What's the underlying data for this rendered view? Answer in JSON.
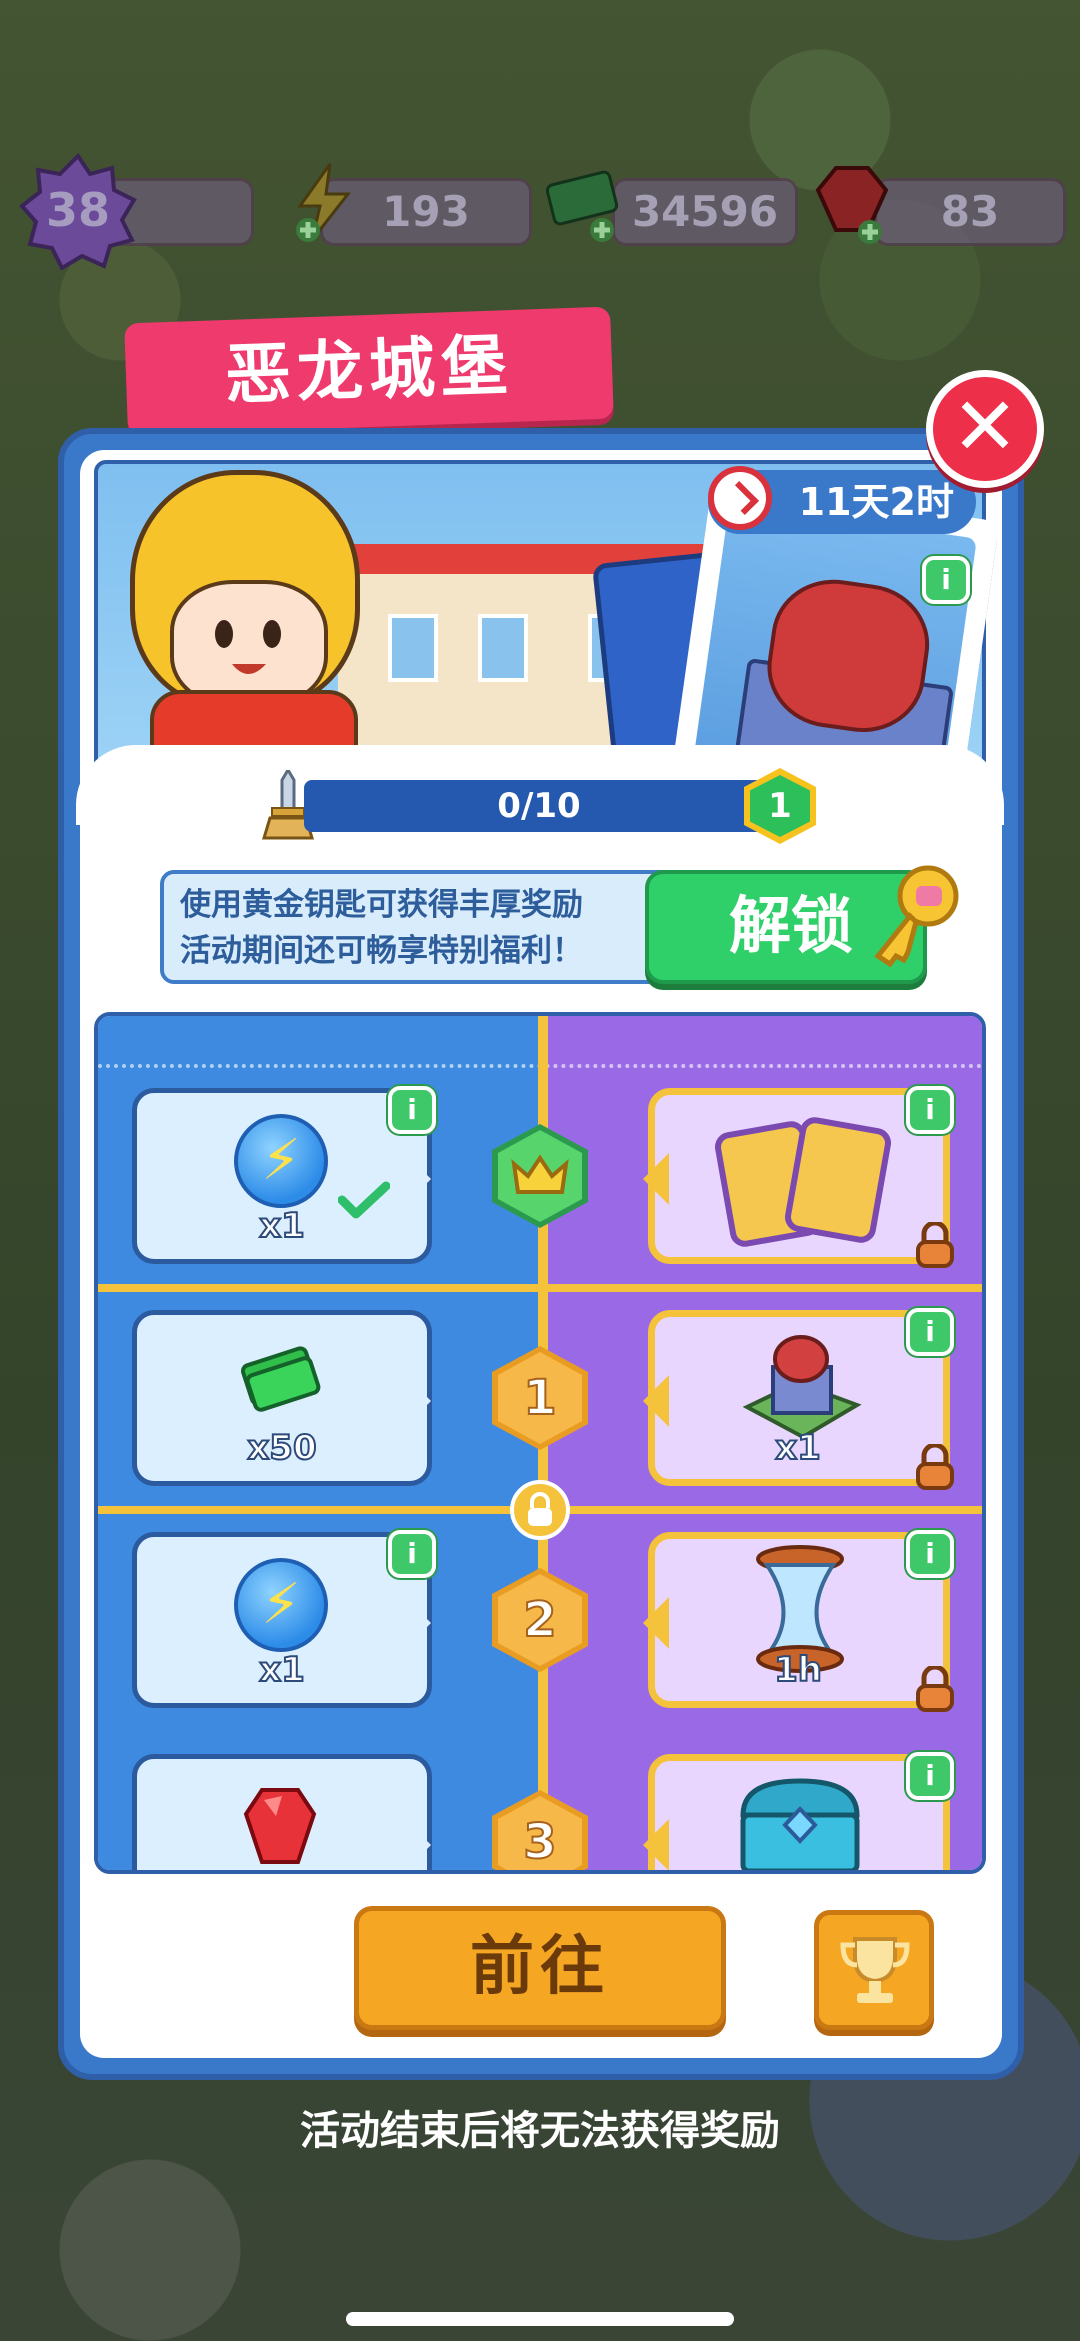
{
  "resources": [
    {
      "name": "level",
      "value": "38"
    },
    {
      "name": "energy",
      "value": "193"
    },
    {
      "name": "cash",
      "value": "34596"
    },
    {
      "name": "gems",
      "value": "83"
    }
  ],
  "window": {
    "title": "恶龙城堡",
    "close_label": "✕",
    "timer": "11天2时"
  },
  "progress": {
    "text": "0/10",
    "level": "1"
  },
  "unlock": {
    "line1": "使用黄金钥匙可获得丰厚奖励",
    "line2": "活动期间还可畅享特别福利！",
    "button": "解锁"
  },
  "rewards": [
    {
      "node": "",
      "free_qty": "x1",
      "premium_qty": ""
    },
    {
      "node": "1",
      "free_qty": "x50",
      "premium_qty": "x1"
    },
    {
      "node": "2",
      "free_qty": "x1",
      "premium_qty": "1h"
    },
    {
      "node": "3",
      "free_qty": "",
      "premium_qty": ""
    }
  ],
  "buttons": {
    "go": "前往"
  },
  "footer_note": "活动结束后将无法获得奖励",
  "colors": {
    "title_tab": "#ee3a6d",
    "window_border": "#3a78c9",
    "unlock_button": "#2fcf6a",
    "go_button": "#f5a623",
    "free_track": "#3e8ae0",
    "premium_track": "#9a6ae6"
  }
}
